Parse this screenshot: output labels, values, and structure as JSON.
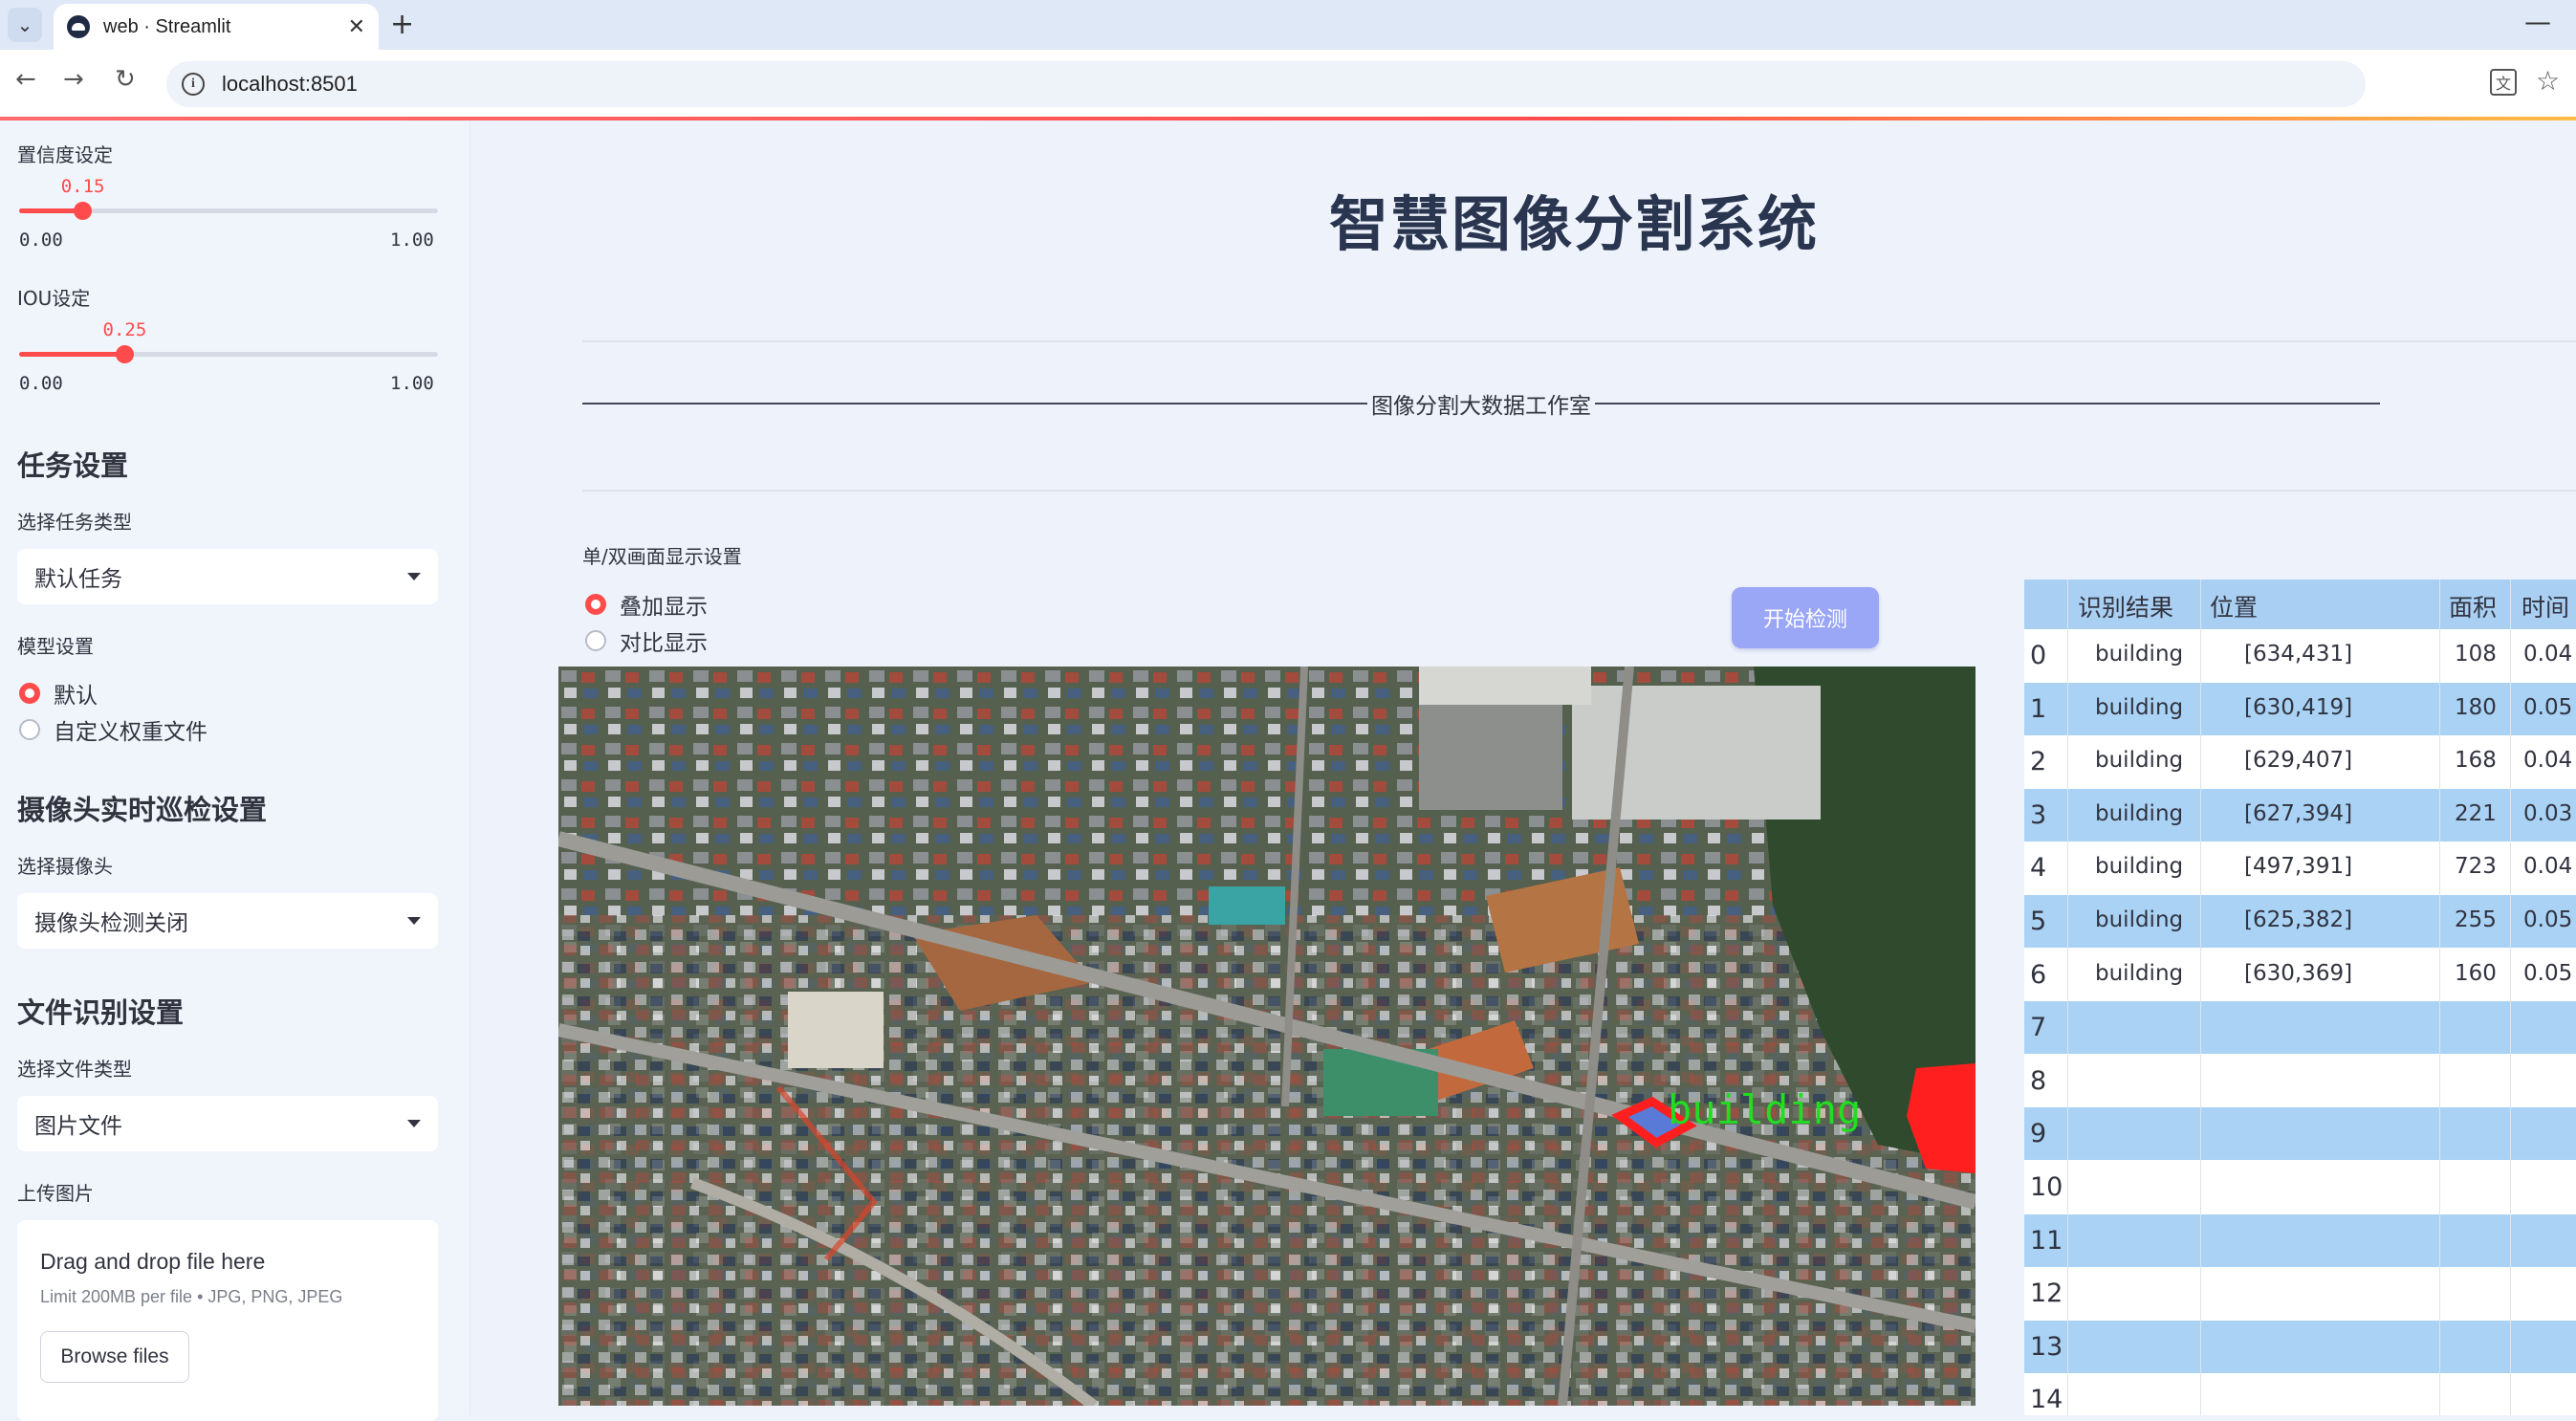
{
  "browser": {
    "tab_title": "web · Streamlit",
    "tab_close": "✕",
    "new_tab": "+",
    "minimize": "—",
    "url": "localhost:8501",
    "nav_back": "←",
    "nav_forward": "→",
    "nav_reload": "↻",
    "info_glyph": "i",
    "translate_glyph": "文",
    "star_glyph": "☆",
    "tab_menu_glyph": "⌄"
  },
  "sidebar": {
    "confidence": {
      "label": "置信度设定",
      "value": 0.15,
      "value_text": "0.15",
      "min": "0.00",
      "max": "1.00"
    },
    "iou": {
      "label": "IOU设定",
      "value": 0.25,
      "value_text": "0.25",
      "min": "0.00",
      "max": "1.00"
    },
    "task_header": "任务设置",
    "task_type_label": "选择任务类型",
    "task_type_value": "默认任务",
    "model_label": "模型设置",
    "model_options": [
      {
        "label": "默认",
        "selected": true
      },
      {
        "label": "自定义权重文件",
        "selected": false
      }
    ],
    "camera_header": "摄像头实时巡检设置",
    "camera_label": "选择摄像头",
    "camera_value": "摄像头检测关闭",
    "file_header": "文件识别设置",
    "file_type_label": "选择文件类型",
    "file_type_value": "图片文件",
    "upload_label": "上传图片",
    "upload_title": "Drag and drop file here",
    "upload_sub": "Limit 200MB per file • JPG, PNG, JPEG",
    "upload_button": "Browse files"
  },
  "main": {
    "title": "智慧图像分割系统",
    "subtitle": "图像分割大数据工作室",
    "display_label": "单/双画面显示设置",
    "display_options": [
      {
        "label": "叠加显示",
        "selected": true
      },
      {
        "label": "对比显示",
        "selected": false
      }
    ],
    "start_button": "开始检测",
    "detection_label": "building"
  },
  "table": {
    "columns": [
      "识别结果",
      "位置",
      "面积",
      "时间"
    ],
    "rows": [
      {
        "idx": "0",
        "result": "building",
        "pos": "[634,431]",
        "area": "108",
        "time": "0.04"
      },
      {
        "idx": "1",
        "result": "building",
        "pos": "[630,419]",
        "area": "180",
        "time": "0.05"
      },
      {
        "idx": "2",
        "result": "building",
        "pos": "[629,407]",
        "area": "168",
        "time": "0.04"
      },
      {
        "idx": "3",
        "result": "building",
        "pos": "[627,394]",
        "area": "221",
        "time": "0.03"
      },
      {
        "idx": "4",
        "result": "building",
        "pos": "[497,391]",
        "area": "723",
        "time": "0.04"
      },
      {
        "idx": "5",
        "result": "building",
        "pos": "[625,382]",
        "area": "255",
        "time": "0.05"
      },
      {
        "idx": "6",
        "result": "building",
        "pos": "[630,369]",
        "area": "160",
        "time": "0.05"
      },
      {
        "idx": "7",
        "result": "",
        "pos": "",
        "area": "",
        "time": ""
      },
      {
        "idx": "8",
        "result": "",
        "pos": "",
        "area": "",
        "time": ""
      },
      {
        "idx": "9",
        "result": "",
        "pos": "",
        "area": "",
        "time": ""
      },
      {
        "idx": "10",
        "result": "",
        "pos": "",
        "area": "",
        "time": ""
      },
      {
        "idx": "11",
        "result": "",
        "pos": "",
        "area": "",
        "time": ""
      },
      {
        "idx": "12",
        "result": "",
        "pos": "",
        "area": "",
        "time": ""
      },
      {
        "idx": "13",
        "result": "",
        "pos": "",
        "area": "",
        "time": ""
      },
      {
        "idx": "14",
        "result": "",
        "pos": "",
        "area": "",
        "time": ""
      }
    ]
  },
  "colors": {
    "accent": "#ff4b4b",
    "button": "#9aa6f6",
    "table_header": "#a9cff3",
    "table_alt_row": "#a9d2f5",
    "detection_box": "#ff1f1f",
    "detection_text": "#22dd22"
  }
}
